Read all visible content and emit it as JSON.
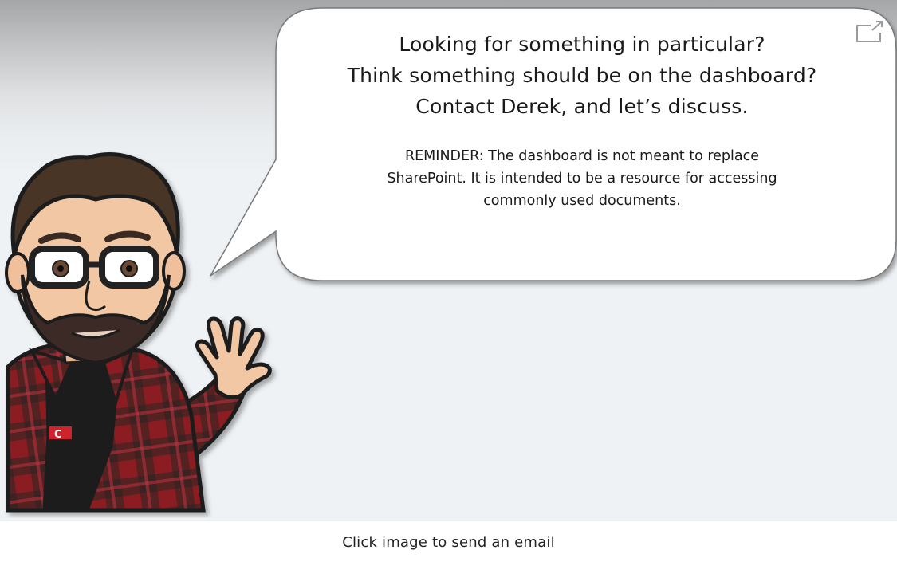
{
  "bubble": {
    "headline_lines": [
      "Looking for something in particular?",
      "Think something should be on the dashboard?",
      "Contact Derek, and let’s discuss."
    ],
    "reminder_lines": [
      "REMINDER: The dashboard is not meant to replace",
      "SharePoint. It is intended to be a resource for accessing",
      "commonly used documents."
    ]
  },
  "caption": "Click image to send an email",
  "icons": {
    "popout": "open-in-new-window-icon",
    "avatar": "waving-man-avatar"
  },
  "colors": {
    "shirt_red": "#8a1c24",
    "shirt_dark": "#2a2224",
    "hair": "#4a3428",
    "skin": "#f2c8a4",
    "bubble": "#ffffff"
  }
}
